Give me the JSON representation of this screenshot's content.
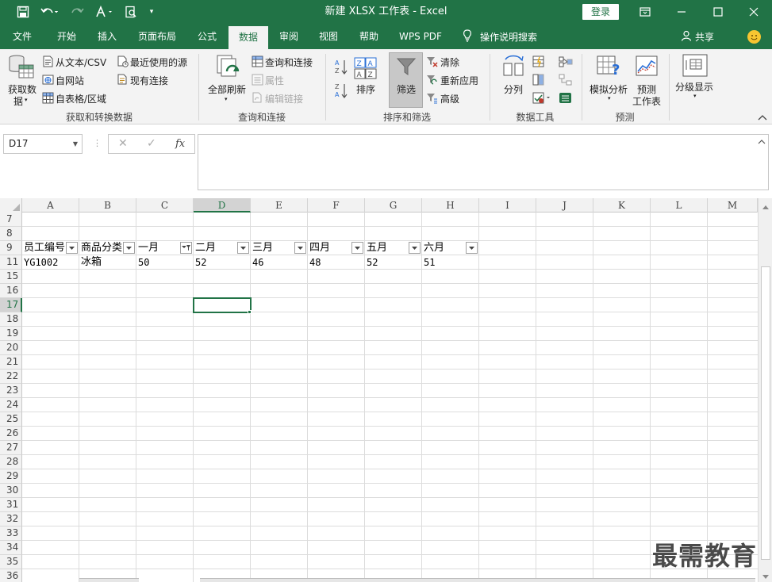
{
  "window": {
    "title": "新建 XLSX 工作表  -  Excel",
    "login_label": "登录"
  },
  "tabs": [
    {
      "label": "文件"
    },
    {
      "label": "开始"
    },
    {
      "label": "插入"
    },
    {
      "label": "页面布局"
    },
    {
      "label": "公式"
    },
    {
      "label": "数据"
    },
    {
      "label": "审阅"
    },
    {
      "label": "视图"
    },
    {
      "label": "帮助"
    },
    {
      "label": "WPS PDF"
    }
  ],
  "tell_me": "操作说明搜索",
  "share": "共享",
  "ribbon": {
    "get_data": {
      "line1": "获取数",
      "line2": "据"
    },
    "from_text_csv": "从文本/CSV",
    "from_web": "自网站",
    "from_table": "自表格/区域",
    "recent_sources": "最近使用的源",
    "existing_connections": "现有连接",
    "group1": "获取和转换数据",
    "refresh_all": "全部刷新",
    "queries_connections": "查询和连接",
    "properties": "属性",
    "edit_links": "编辑链接",
    "group2": "查询和连接",
    "sort": "排序",
    "filter": "筛选",
    "clear": "清除",
    "reapply": "重新应用",
    "advanced": "高级",
    "group3": "排序和筛选",
    "text_to_columns": "分列",
    "group4": "数据工具",
    "what_if": "模拟分析",
    "forecast_line1": "预测",
    "forecast_line2": "工作表",
    "group5": "预测",
    "outline": "分级显示"
  },
  "formula_bar": {
    "name_box": "D17",
    "fx": "fx",
    "formula": ""
  },
  "sheet": {
    "columns": [
      "A",
      "B",
      "C",
      "D",
      "E",
      "F",
      "G",
      "H",
      "I",
      "J",
      "K",
      "L",
      "M"
    ],
    "selected_column": "D",
    "selected_row": "17",
    "rows": [
      "7",
      "8",
      "9",
      "11",
      "15",
      "16",
      "17",
      "18",
      "19",
      "20",
      "21",
      "22",
      "23",
      "24",
      "25",
      "26",
      "27",
      "28",
      "29",
      "30",
      "31",
      "32",
      "33",
      "34",
      "35",
      "36"
    ],
    "header_cells": [
      "员工编号",
      "商品分类",
      "一月",
      "二月",
      "三月",
      "四月",
      "五月",
      "六月"
    ],
    "data_row": [
      "YG1002",
      "冰箱",
      "50",
      "52",
      "46",
      "48",
      "52",
      "51"
    ]
  },
  "watermark": "最需教育"
}
